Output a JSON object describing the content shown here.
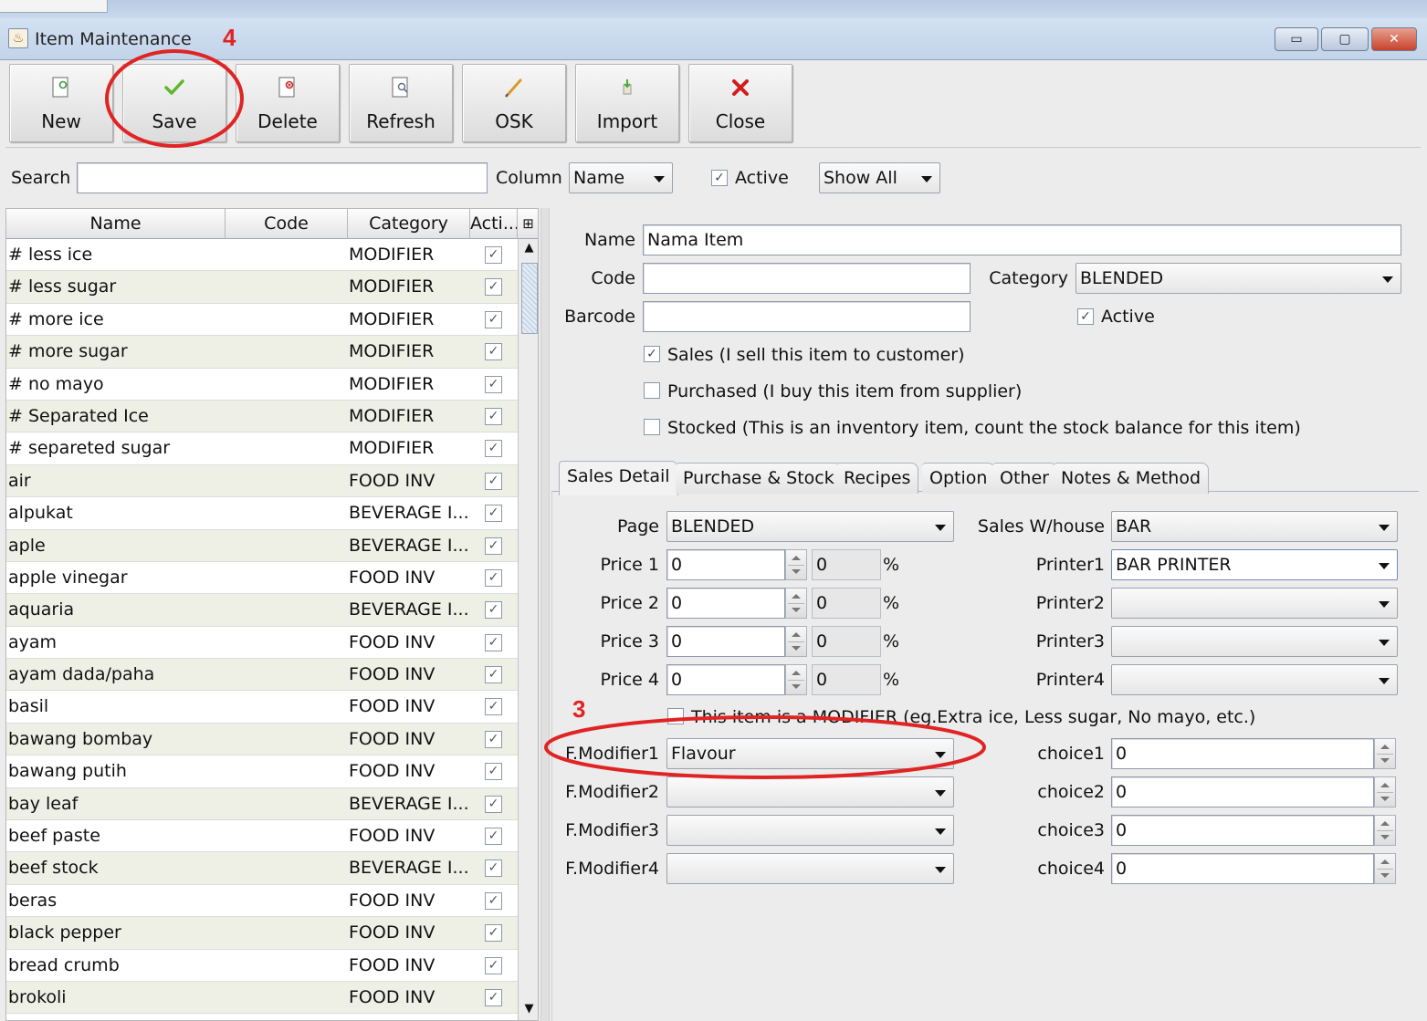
{
  "window": {
    "title": "Item Maintenance",
    "min_glyph": "▭",
    "max_glyph": "▢",
    "close_glyph": "✕"
  },
  "toolbar": {
    "new_label": "New",
    "save_label": "Save",
    "delete_label": "Delete",
    "refresh_label": "Refresh",
    "osk_label": "OSK",
    "import_label": "Import",
    "close_label": "Close"
  },
  "search": {
    "label": "Search",
    "value": "",
    "column_label": "Column",
    "column_value": "Name",
    "active_label": "Active",
    "active_checked": true,
    "filter_value": "Show All"
  },
  "table": {
    "headers": [
      "Name",
      "Code",
      "Category",
      "Acti..."
    ],
    "rows": [
      {
        "name": "# less ice",
        "code": "",
        "category": "MODIFIER",
        "active": true
      },
      {
        "name": "# less sugar",
        "code": "",
        "category": "MODIFIER",
        "active": true
      },
      {
        "name": "# more ice",
        "code": "",
        "category": "MODIFIER",
        "active": true
      },
      {
        "name": "# more sugar",
        "code": "",
        "category": "MODIFIER",
        "active": true
      },
      {
        "name": "# no mayo",
        "code": "",
        "category": "MODIFIER",
        "active": true
      },
      {
        "name": "# Separated Ice",
        "code": "",
        "category": "MODIFIER",
        "active": true
      },
      {
        "name": "# separeted sugar",
        "code": "",
        "category": "MODIFIER",
        "active": true
      },
      {
        "name": "air",
        "code": "",
        "category": "FOOD INV",
        "active": true
      },
      {
        "name": "alpukat",
        "code": "",
        "category": "BEVERAGE I...",
        "active": true
      },
      {
        "name": "aple",
        "code": "",
        "category": "BEVERAGE I...",
        "active": true
      },
      {
        "name": "apple vinegar",
        "code": "",
        "category": "FOOD INV",
        "active": true
      },
      {
        "name": "aquaria",
        "code": "",
        "category": "BEVERAGE I...",
        "active": true
      },
      {
        "name": "ayam",
        "code": "",
        "category": "FOOD INV",
        "active": true
      },
      {
        "name": "ayam dada/paha",
        "code": "",
        "category": "FOOD INV",
        "active": true
      },
      {
        "name": "basil",
        "code": "",
        "category": "FOOD INV",
        "active": true
      },
      {
        "name": "bawang bombay",
        "code": "",
        "category": "FOOD INV",
        "active": true
      },
      {
        "name": "bawang putih",
        "code": "",
        "category": "FOOD INV",
        "active": true
      },
      {
        "name": "bay leaf",
        "code": "",
        "category": "BEVERAGE I...",
        "active": true
      },
      {
        "name": "beef paste",
        "code": "",
        "category": "FOOD INV",
        "active": true
      },
      {
        "name": "beef stock",
        "code": "",
        "category": "BEVERAGE I...",
        "active": true
      },
      {
        "name": "beras",
        "code": "",
        "category": "FOOD INV",
        "active": true
      },
      {
        "name": "black pepper",
        "code": "",
        "category": "FOOD INV",
        "active": true
      },
      {
        "name": "bread crumb",
        "code": "",
        "category": "FOOD INV",
        "active": true
      },
      {
        "name": "brokoli",
        "code": "",
        "category": "FOOD INV",
        "active": true
      }
    ]
  },
  "form": {
    "name_label": "Name",
    "name_value": "Nama Item",
    "code_label": "Code",
    "code_value": "",
    "category_label": "Category",
    "category_value": "BLENDED",
    "barcode_label": "Barcode",
    "barcode_value": "",
    "active_label": "Active",
    "active_checked": true,
    "sales_label": "Sales (I sell this item to customer)",
    "sales_checked": true,
    "purchased_label": "Purchased (I buy this item from supplier)",
    "purchased_checked": false,
    "stocked_label": "Stocked (This is an inventory item, count the stock balance for this item)",
    "stocked_checked": false
  },
  "tabs": [
    "Sales Detail",
    "Purchase & Stock",
    "Recipes",
    "Option",
    "Other",
    "Notes & Method"
  ],
  "sales_detail": {
    "page_label": "Page",
    "page_value": "BLENDED",
    "warehouse_label": "Sales W/house",
    "warehouse_value": "BAR",
    "prices": [
      {
        "label": "Price 1",
        "value": "0",
        "pct": "0",
        "pct_sign": "%"
      },
      {
        "label": "Price 2",
        "value": "0",
        "pct": "0",
        "pct_sign": "%"
      },
      {
        "label": "Price 3",
        "value": "0",
        "pct": "0",
        "pct_sign": "%"
      },
      {
        "label": "Price 4",
        "value": "0",
        "pct": "0",
        "pct_sign": "%"
      }
    ],
    "printers": [
      {
        "label": "Printer1",
        "value": "BAR PRINTER"
      },
      {
        "label": "Printer2",
        "value": ""
      },
      {
        "label": "Printer3",
        "value": ""
      },
      {
        "label": "Printer4",
        "value": ""
      }
    ],
    "modifier_checkbox_label": "This item is a MODIFIER (eg.Extra ice, Less sugar, No mayo, etc.)",
    "modifier_checked": false,
    "modifiers": [
      {
        "label": "F.Modifier1",
        "value": "Flavour"
      },
      {
        "label": "F.Modifier2",
        "value": ""
      },
      {
        "label": "F.Modifier3",
        "value": ""
      },
      {
        "label": "F.Modifier4",
        "value": ""
      }
    ],
    "choices": [
      {
        "label": "choice1",
        "value": "0"
      },
      {
        "label": "choice2",
        "value": "0"
      },
      {
        "label": "choice3",
        "value": "0"
      },
      {
        "label": "choice4",
        "value": "0"
      }
    ]
  },
  "annotations": {
    "step_save": "4",
    "step_modifier": "3",
    "color": "#e02424"
  }
}
